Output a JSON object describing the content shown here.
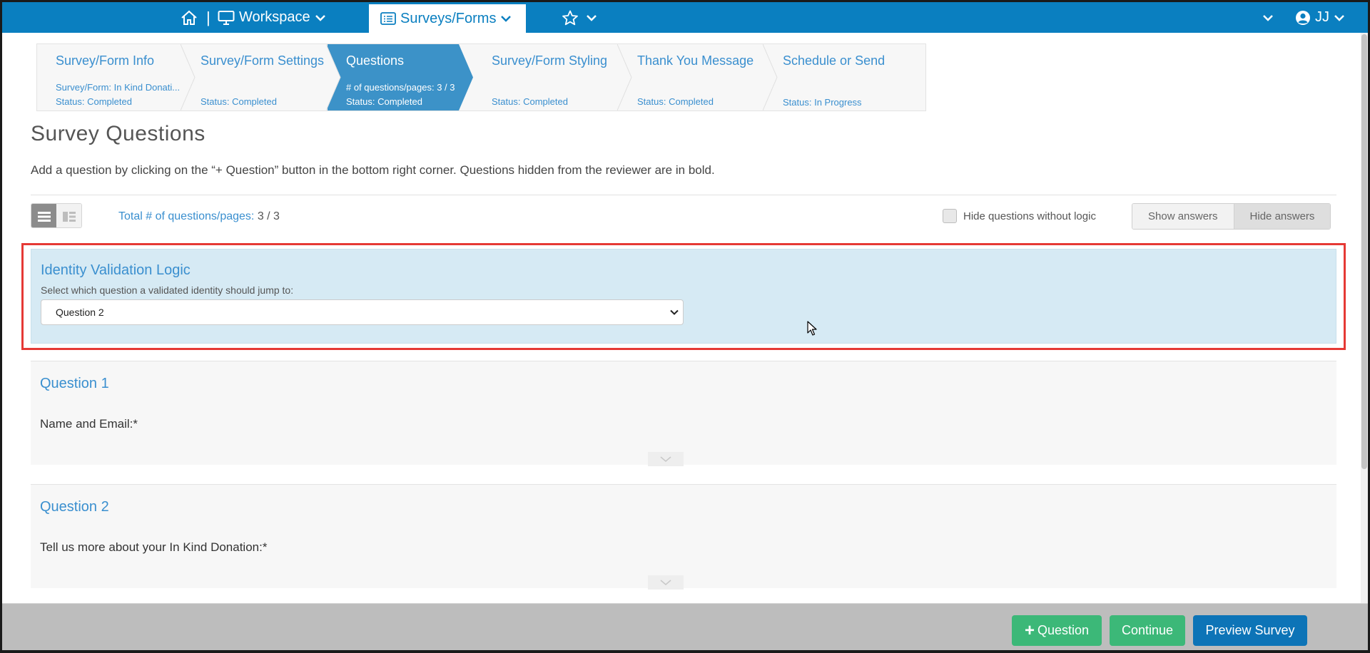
{
  "topbar": {
    "separator": "|",
    "workspace_label": "Workspace",
    "surveys_label": "Surveys/Forms",
    "user_initials": "JJ",
    "colors": {
      "bar": "#0a7fc0",
      "active_tab_text": "#0a7fc0"
    }
  },
  "steps": [
    {
      "title": "Survey/Form Info",
      "sub1": "Survey/Form: In Kind Donati...",
      "sub2": "Status: Completed",
      "active": false
    },
    {
      "title": "Survey/Form Settings",
      "sub1": "",
      "sub2": "Status: Completed",
      "active": false
    },
    {
      "title": "Questions",
      "sub1": "# of questions/pages: 3 / 3",
      "sub2": "Status: Completed",
      "active": true
    },
    {
      "title": "Survey/Form Styling",
      "sub1": "",
      "sub2": "Status: Completed",
      "active": false
    },
    {
      "title": "Thank You Message",
      "sub1": "",
      "sub2": "Status: Completed",
      "active": false
    },
    {
      "title": "Schedule or Send",
      "sub1": "",
      "sub2": "Status: In Progress",
      "active": false
    }
  ],
  "page": {
    "title": "Survey Questions",
    "description": "Add a question by clicking on the “+ Question” button in the bottom right corner. Questions hidden from the reviewer are in bold."
  },
  "toolbar": {
    "total_label": "Total # of questions/pages:",
    "total_value": "3 / 3",
    "hide_logic_label": "Hide questions without logic",
    "hide_logic_checked": false,
    "show_answers_label": "Show answers",
    "hide_answers_label": "Hide answers"
  },
  "identity_logic": {
    "title": "Identity Validation Logic",
    "instruction": "Select which question a validated identity should jump to:",
    "selected": "Question 2"
  },
  "questions": [
    {
      "title": "Question 1",
      "text": "Name and Email:*"
    },
    {
      "title": "Question 2",
      "text": "Tell us more about your In Kind Donation:*"
    }
  ],
  "footer": {
    "add_question_label": "Question",
    "continue_label": "Continue",
    "preview_label": "Preview Survey"
  },
  "icons": [
    "home-icon",
    "monitor-icon",
    "list-icon",
    "star-icon",
    "user-circle-icon",
    "chevron-down-icon",
    "list-view-icon",
    "grid-view-icon",
    "plus-icon",
    "mouse-cursor-icon"
  ],
  "colors": {
    "accent": "#3a8fcf",
    "highlight_border": "#e53935",
    "logic_panel": "#d6eaf4",
    "green_button": "#3cb878",
    "blue_button": "#0d74b7"
  }
}
